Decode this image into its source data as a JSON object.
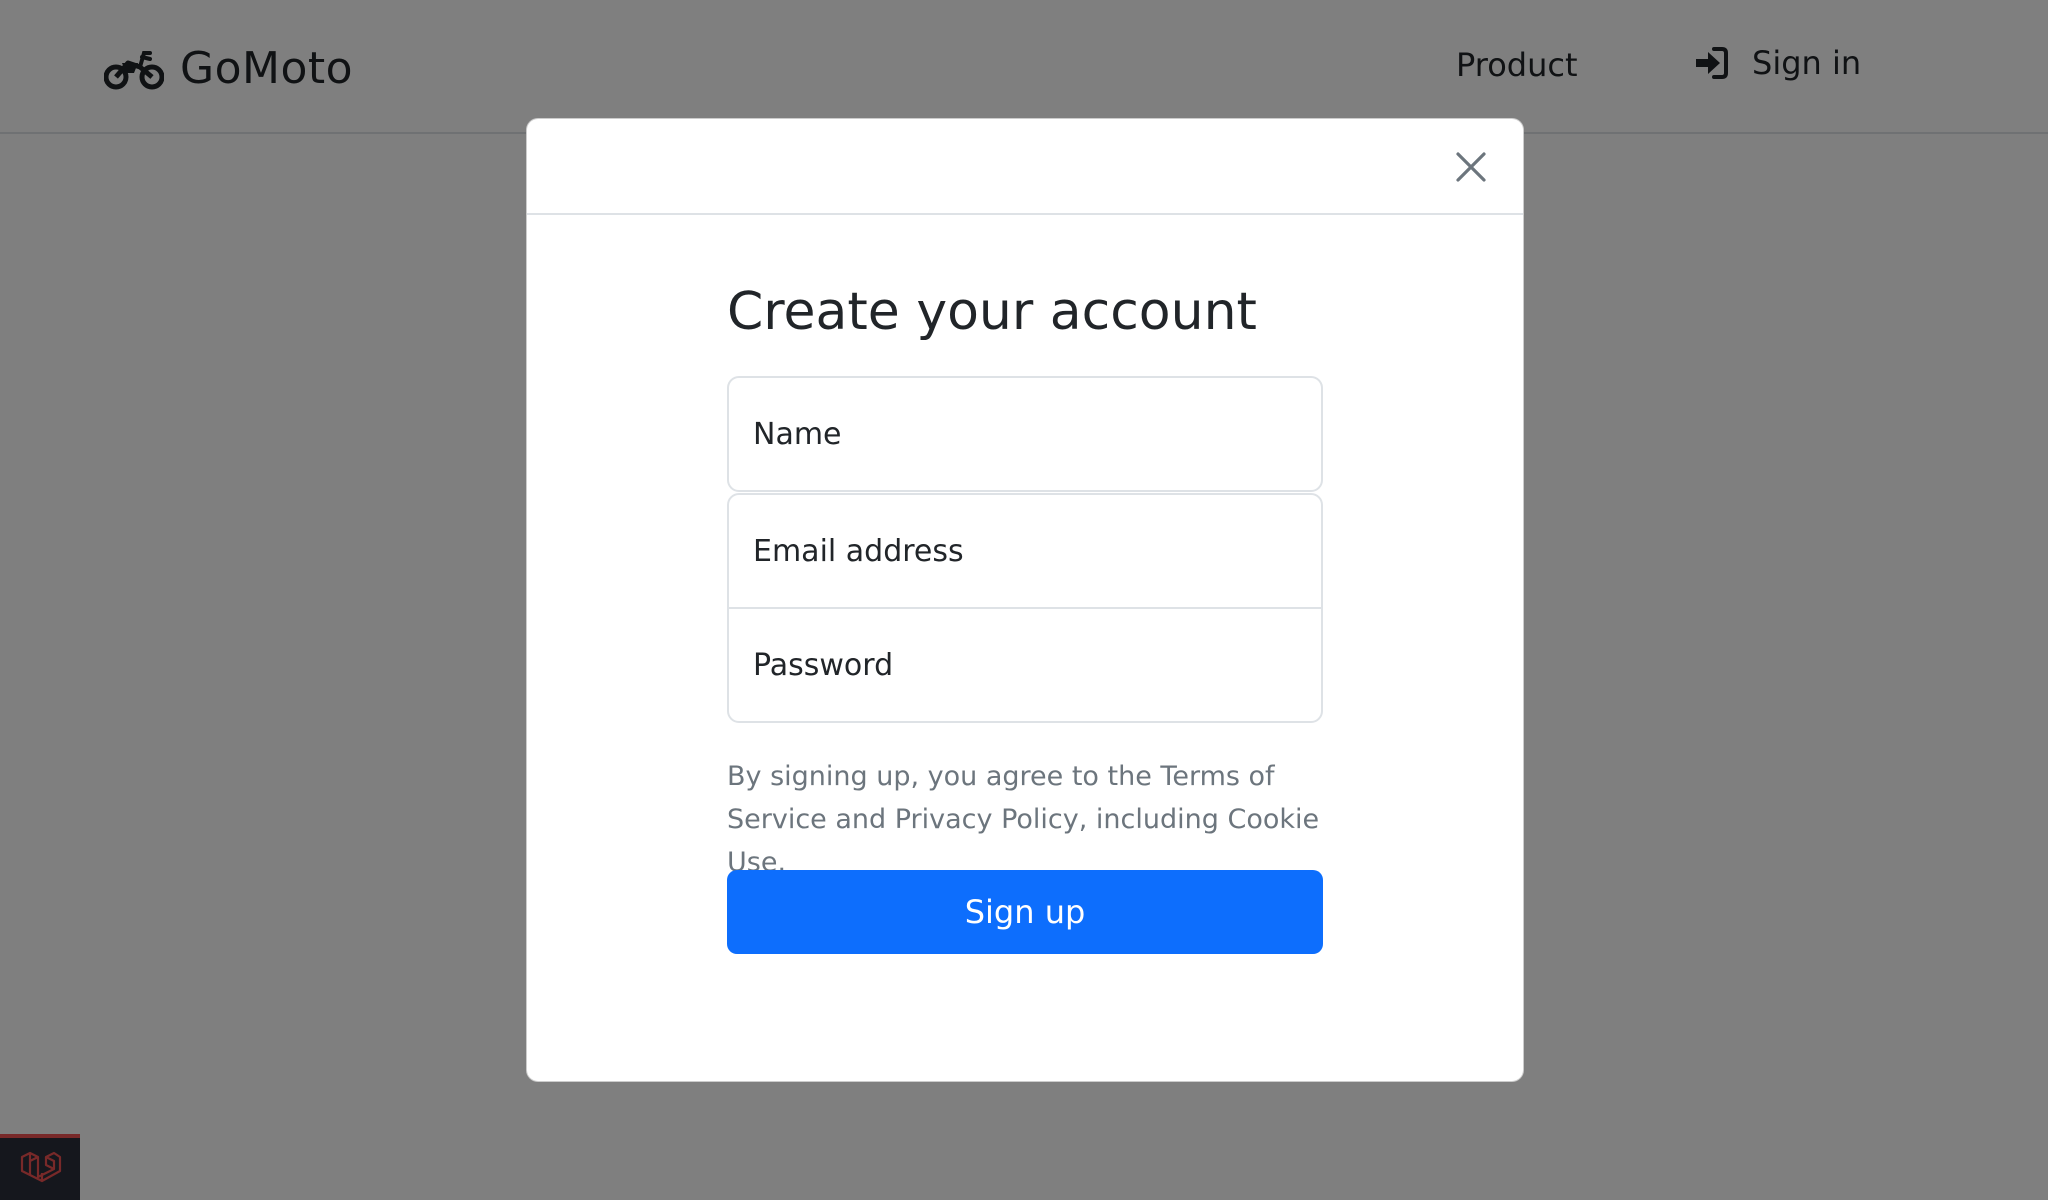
{
  "navbar": {
    "brand": "GoMoto",
    "brand_icon": "motorcycle-icon",
    "product_label": "Product",
    "signin_label": "Sign in",
    "signin_icon": "sign-in-icon"
  },
  "modal": {
    "close_icon": "close-icon",
    "title": "Create your account",
    "fields": {
      "name_placeholder": "Name",
      "email_placeholder": "Email address",
      "password_placeholder": "Password"
    },
    "terms": "By signing up, you agree to the Terms of Service and Privacy Policy, including Cookie Use.",
    "signup_label": "Sign up"
  },
  "debug_badge": {
    "icon": "laravel-icon"
  },
  "colors": {
    "primary": "#0d6efd",
    "backdrop": "rgba(0,0,0,0.5)",
    "muted_text": "#6c757d",
    "debug_accent": "#f05252"
  }
}
